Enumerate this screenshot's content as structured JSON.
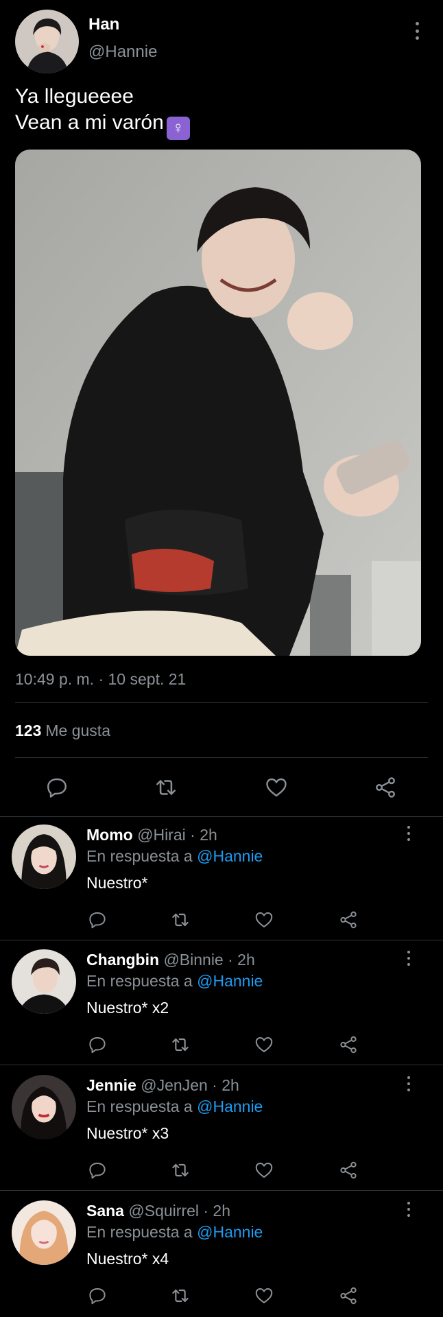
{
  "main_tweet": {
    "author_name": "Han",
    "author_handle": "@Hannie",
    "text": "Ya llegueeee\nVean a mi varón",
    "emoji": "🚺",
    "timestamp": "10:49 p. m. · 10 sept. 21",
    "likes_count": "123",
    "likes_label": "Me gusta",
    "actions": [
      "reply-icon",
      "retweet-icon",
      "like-icon",
      "share-icon"
    ]
  },
  "replies": [
    {
      "name": "Momo",
      "handle": "@Hirai",
      "time": "· 2h",
      "reply_prefix": "En respuesta a ",
      "mention": "@Hannie",
      "text": "Nuestro*"
    },
    {
      "name": "Changbin",
      "handle": "@Binnie",
      "time": "· 2h",
      "reply_prefix": "En respuesta a ",
      "mention": "@Hannie",
      "text": "Nuestro* x2"
    },
    {
      "name": "Jennie",
      "handle": "@JenJen",
      "time": "· 2h",
      "reply_prefix": "En respuesta a ",
      "mention": "@Hannie",
      "text": "Nuestro* x3"
    },
    {
      "name": "Sana",
      "handle": "@Squirrel",
      "time": "· 2h",
      "reply_prefix": "En respuesta a ",
      "mention": "@Hannie",
      "text": "Nuestro* x4"
    }
  ],
  "colors": {
    "background": "#000000",
    "secondary_text": "#8b9196",
    "mention": "#1d9bf0",
    "divider": "#2f3336"
  }
}
